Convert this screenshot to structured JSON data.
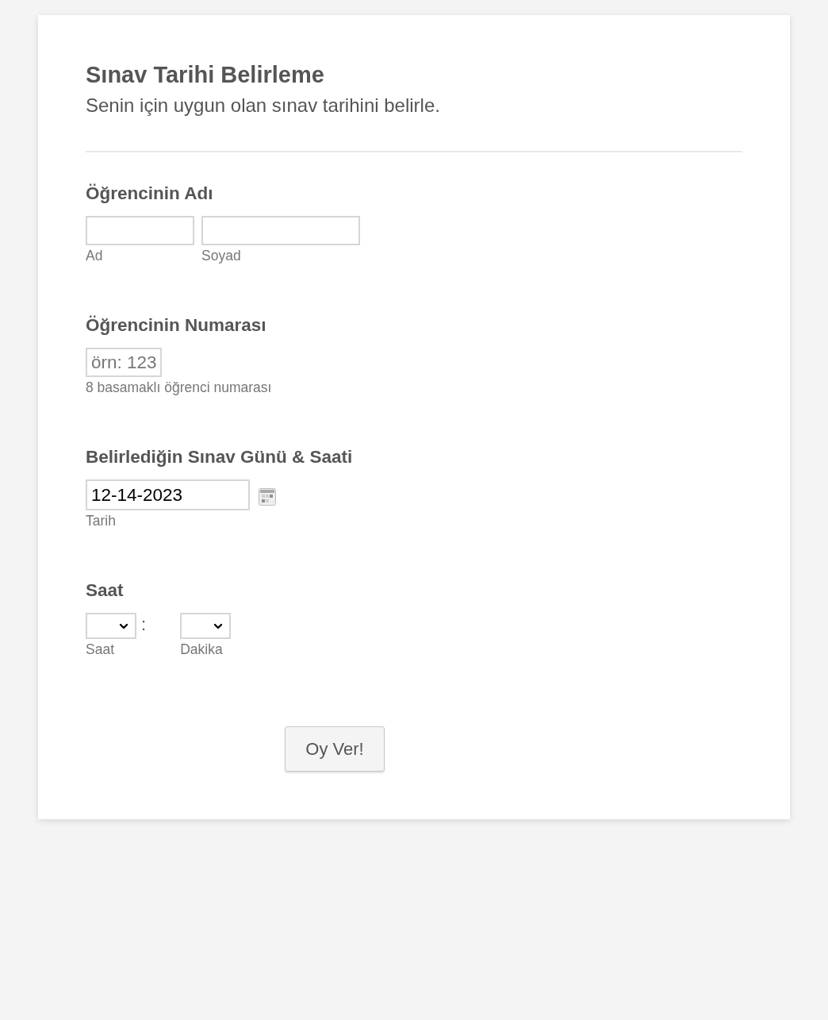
{
  "form": {
    "title": "Sınav Tarihi Belirleme",
    "description": "Senin için uygun olan sınav tarihini belirle."
  },
  "fields": [
    {
      "kind": "full_name",
      "label": "Öğrencinin Adı",
      "inputs": [
        {
          "sublabel": "Ad"
        },
        {
          "sublabel": "Soyad"
        }
      ]
    },
    {
      "kind": "text",
      "label": "Öğrencinin Numarası",
      "placeholder": "örn: 123",
      "sublabel": "8 basamaklı öğrenci numarası"
    },
    {
      "kind": "date",
      "label": "Belirlediğin Sınav Günü & Saati",
      "value": "12-14-2023",
      "sublabel": "Tarih"
    },
    {
      "kind": "time",
      "label": "Saat",
      "separator": ":",
      "selects": [
        {
          "sublabel": "Saat"
        },
        {
          "sublabel": "Dakika"
        }
      ]
    }
  ],
  "submit_button": {
    "label": "Oy Ver!"
  }
}
